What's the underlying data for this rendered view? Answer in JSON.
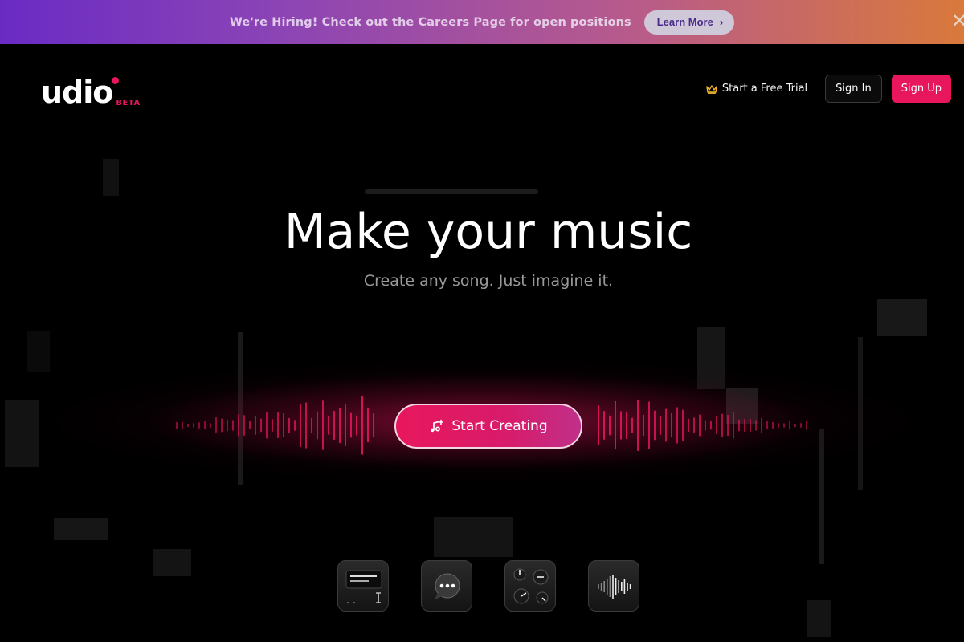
{
  "banner": {
    "text": "We're Hiring! Check out the Careers Page for open positions",
    "button_label": "Learn More",
    "close_icon": "close-icon"
  },
  "header": {
    "logo_text": "udio",
    "logo_badge": "BETA",
    "trial_label": "Start a Free Trial",
    "signin_label": "Sign In",
    "signup_label": "Sign Up"
  },
  "hero": {
    "title": "Make your music",
    "subtitle": "Create any song. Just imagine it.",
    "cta_label": "Start Creating"
  },
  "features": [
    {
      "icon": "lyrics-editor-icon"
    },
    {
      "icon": "chat-bubble-icon"
    },
    {
      "icon": "knobs-controls-icon"
    },
    {
      "icon": "waveform-icon"
    }
  ],
  "colors": {
    "accent": "#e8175d",
    "banner_start": "#6a2bc4",
    "banner_end": "#d9793b",
    "background": "#000000"
  }
}
